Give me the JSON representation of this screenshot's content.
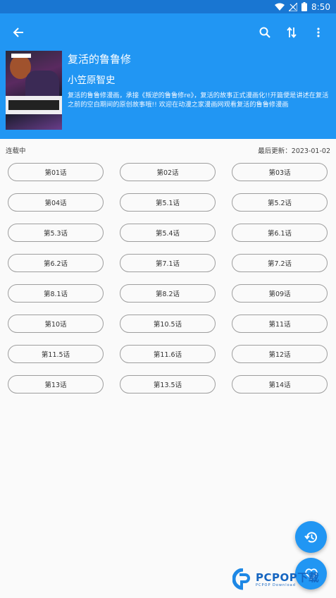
{
  "status_bar": {
    "time": "8:50"
  },
  "toolbar": {
    "back_icon": "arrow-back-icon",
    "search_icon": "search-icon",
    "sort_icon": "sort-icon",
    "more_icon": "more-vert-icon"
  },
  "comic": {
    "title": "复活的鲁鲁修",
    "author": "小笠原智史",
    "description": "复活的鲁鲁修漫画，承接《叛逆的鲁鲁修re》，复活的故事正式漫画化!!开篇便是讲述在复活之前的空白期间的原创故事哦!! 欢迎在动漫之家漫画网观看复活的鲁鲁修漫画"
  },
  "meta": {
    "status": "连载中",
    "last_update": "最后更新：2023-01-02"
  },
  "chapters": [
    "第01话",
    "第02话",
    "第03话",
    "第04话",
    "第5.1话",
    "第5.2话",
    "第5.3话",
    "第5.4话",
    "第6.1话",
    "第6.2话",
    "第7.1话",
    "第7.2话",
    "第8.1话",
    "第8.2话",
    "第09话",
    "第10话",
    "第10.5话",
    "第11话",
    "第11.5话",
    "第11.6话",
    "第12话",
    "第13话",
    "第13.5话",
    "第14话"
  ],
  "fabs": {
    "history_icon": "history-icon",
    "favorite_icon": "heart-icon"
  },
  "watermark": {
    "main": "PCPOP下载",
    "sub": "PCPOP Download"
  },
  "colors": {
    "primary": "#2196f3",
    "status_bar": "#1976d2",
    "background": "#fafafa"
  }
}
